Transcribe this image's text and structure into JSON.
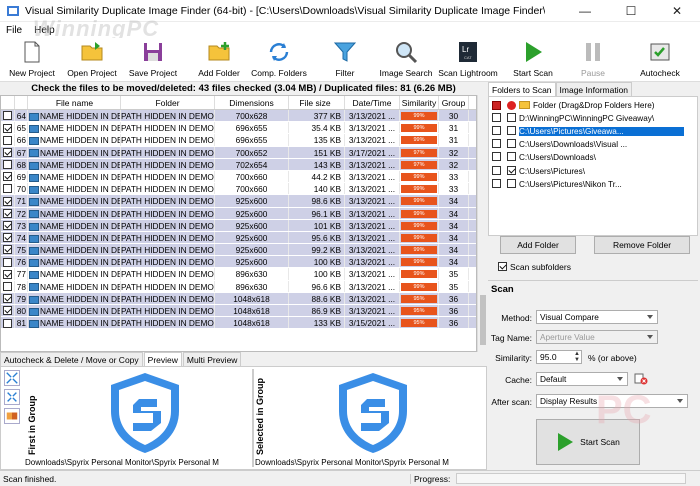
{
  "window": {
    "title": "Visual Similarity Duplicate Image Finder (64-bit) - [C:\\Users\\Downloads\\Visual Similarity Duplicate Image Finder\\Vis...",
    "minimize": "—",
    "maximize": "☐",
    "close": "✕"
  },
  "menu": {
    "file": "File",
    "help": "Help"
  },
  "watermark": "WinningPC",
  "toolbar": {
    "new_project": "New Project",
    "open_project": "Open Project",
    "save_project": "Save Project",
    "add_folder": "Add Folder",
    "comp_folders": "Comp. Folders",
    "filter": "Filter",
    "image_search": "Image Search",
    "scan_lightroom": "Scan Lightroom",
    "start_scan": "Start Scan",
    "pause": "Pause",
    "autocheck": "Autocheck"
  },
  "results": {
    "message": "Check the files to be moved/deleted: 43 files checked (3.04 MB) / Duplicated files: 81 (6.26 MB)",
    "headers": [
      "",
      "",
      "File name",
      "Folder",
      "Dimensions",
      "File size",
      "Date/Time",
      "Similarity",
      "Group"
    ],
    "rows": [
      {
        "n": "64",
        "checked": false,
        "name": "NAME HIDDEN IN DEM",
        "folder": "PATH HIDDEN IN DEMO",
        "dim": "700x628",
        "size": "377 KB",
        "date": "3/13/2021 ...",
        "sim": "99%",
        "group": "30",
        "hl": true
      },
      {
        "n": "65",
        "checked": true,
        "name": "NAME HIDDEN IN DEM",
        "folder": "PATH HIDDEN IN DEMO",
        "dim": "696x655",
        "size": "35.4 KB",
        "date": "3/13/2021 ...",
        "sim": "99%",
        "group": "31",
        "hl": false
      },
      {
        "n": "66",
        "checked": false,
        "name": "NAME HIDDEN IN DEM",
        "folder": "PATH HIDDEN IN DEMO",
        "dim": "696x655",
        "size": "135 KB",
        "date": "3/13/2021 ...",
        "sim": "99%",
        "group": "31",
        "hl": false
      },
      {
        "n": "67",
        "checked": true,
        "name": "NAME HIDDEN IN DEM",
        "folder": "PATH HIDDEN IN DEMO",
        "dim": "700x652",
        "size": "151 KB",
        "date": "3/17/2021 ...",
        "sim": "97%",
        "group": "32",
        "hl": true
      },
      {
        "n": "68",
        "checked": false,
        "name": "NAME HIDDEN IN DEM",
        "folder": "PATH HIDDEN IN DEMO",
        "dim": "702x654",
        "size": "143 KB",
        "date": "3/13/2021 ...",
        "sim": "97%",
        "group": "32",
        "hl": true
      },
      {
        "n": "69",
        "checked": true,
        "name": "NAME HIDDEN IN DEM",
        "folder": "PATH HIDDEN IN DEMO",
        "dim": "700x660",
        "size": "44.2 KB",
        "date": "3/13/2021 ...",
        "sim": "99%",
        "group": "33",
        "hl": false
      },
      {
        "n": "70",
        "checked": false,
        "name": "NAME HIDDEN IN DEM",
        "folder": "PATH HIDDEN IN DEMO",
        "dim": "700x660",
        "size": "140 KB",
        "date": "3/13/2021 ...",
        "sim": "99%",
        "group": "33",
        "hl": false
      },
      {
        "n": "71",
        "checked": true,
        "name": "NAME HIDDEN IN DEM",
        "folder": "PATH HIDDEN IN DEMO",
        "dim": "925x600",
        "size": "98.6 KB",
        "date": "3/13/2021 ...",
        "sim": "99%",
        "group": "34",
        "hl": true
      },
      {
        "n": "72",
        "checked": true,
        "name": "NAME HIDDEN IN DEM",
        "folder": "PATH HIDDEN IN DEMO",
        "dim": "925x600",
        "size": "96.1 KB",
        "date": "3/13/2021 ...",
        "sim": "99%",
        "group": "34",
        "hl": true
      },
      {
        "n": "73",
        "checked": true,
        "name": "NAME HIDDEN IN DEM",
        "folder": "PATH HIDDEN IN DEMO",
        "dim": "925x600",
        "size": "101 KB",
        "date": "3/13/2021 ...",
        "sim": "99%",
        "group": "34",
        "hl": true
      },
      {
        "n": "74",
        "checked": true,
        "name": "NAME HIDDEN IN DEM",
        "folder": "PATH HIDDEN IN DEMO",
        "dim": "925x600",
        "size": "95.6 KB",
        "date": "3/13/2021 ...",
        "sim": "99%",
        "group": "34",
        "hl": true
      },
      {
        "n": "75",
        "checked": true,
        "name": "NAME HIDDEN IN DEM",
        "folder": "PATH HIDDEN IN DEMO",
        "dim": "925x600",
        "size": "99.2 KB",
        "date": "3/13/2021 ...",
        "sim": "99%",
        "group": "34",
        "hl": true
      },
      {
        "n": "76",
        "checked": false,
        "name": "NAME HIDDEN IN DEM",
        "folder": "PATH HIDDEN IN DEMO",
        "dim": "925x600",
        "size": "100 KB",
        "date": "3/13/2021 ...",
        "sim": "99%",
        "group": "34",
        "hl": true
      },
      {
        "n": "77",
        "checked": true,
        "name": "NAME HIDDEN IN DEM",
        "folder": "PATH HIDDEN IN DEMO",
        "dim": "896x630",
        "size": "100 KB",
        "date": "3/13/2021 ...",
        "sim": "99%",
        "group": "35",
        "hl": false
      },
      {
        "n": "78",
        "checked": false,
        "name": "NAME HIDDEN IN DEM",
        "folder": "PATH HIDDEN IN DEMO",
        "dim": "896x630",
        "size": "96.6 KB",
        "date": "3/13/2021 ...",
        "sim": "99%",
        "group": "35",
        "hl": false
      },
      {
        "n": "79",
        "checked": true,
        "name": "NAME HIDDEN IN DEM",
        "folder": "PATH HIDDEN IN DEMO",
        "dim": "1048x618",
        "size": "88.6 KB",
        "date": "3/13/2021 ...",
        "sim": "95%",
        "group": "36",
        "hl": true
      },
      {
        "n": "80",
        "checked": true,
        "name": "NAME HIDDEN IN DEM",
        "folder": "PATH HIDDEN IN DEMO",
        "dim": "1048x618",
        "size": "86.9 KB",
        "date": "3/13/2021 ...",
        "sim": "95%",
        "group": "36",
        "hl": true
      },
      {
        "n": "81",
        "checked": false,
        "name": "NAME HIDDEN IN DEM",
        "folder": "PATH HIDDEN IN DEMO",
        "dim": "1048x618",
        "size": "133 KB",
        "date": "3/15/2021 ...",
        "sim": "95%",
        "group": "36",
        "hl": true
      }
    ]
  },
  "bottom_tabs": {
    "autocheck": "Autocheck & Delete / Move or Copy",
    "preview": "Preview",
    "multi_preview": "Multi Preview"
  },
  "preview": {
    "first_label": "First in Group",
    "selected_label": "Selected in Group",
    "first_path": "Downloads\\Spyrix Personal Monitor\\Spyrix Personal M",
    "selected_path": "Downloads\\Spyrix Personal Monitor\\Spyrix Personal M"
  },
  "right_tabs": {
    "folders": "Folders to Scan",
    "image_info": "Image Information"
  },
  "folders": [
    {
      "label": "Folder (Drag&Drop Folders Here)",
      "c1": false,
      "c2": false,
      "header": true,
      "sel": false
    },
    {
      "label": "D:\\WinningPC\\WinningPC Giveaway\\",
      "c1": false,
      "c2": false,
      "header": false,
      "sel": false
    },
    {
      "label": "C:\\Users\\Pictures\\Giveawa...",
      "c1": false,
      "c2": false,
      "header": false,
      "sel": true
    },
    {
      "label": "C:\\Users\\Downloads\\Visual ...",
      "c1": false,
      "c2": false,
      "header": false,
      "sel": false
    },
    {
      "label": "C:\\Users\\Downloads\\",
      "c1": false,
      "c2": false,
      "header": false,
      "sel": false
    },
    {
      "label": "C:\\Users\\Pictures\\",
      "c1": true,
      "c2": false,
      "header": false,
      "sel": false
    },
    {
      "label": "C:\\Users\\Pictures\\Nikon Tr...",
      "c1": false,
      "c2": false,
      "header": false,
      "sel": false
    }
  ],
  "folder_buttons": {
    "add": "Add Folder",
    "remove": "Remove Folder",
    "scan_sub": "Scan subfolders"
  },
  "scan": {
    "header": "Scan",
    "method_label": "Method:",
    "method_value": "Visual Compare",
    "tag_label": "Tag Name:",
    "tag_value": "Aperture Value",
    "similarity_label": "Similarity:",
    "similarity_value": "95.0",
    "similarity_suffix": "% (or above)",
    "cache_label": "Cache:",
    "cache_value": "Default",
    "after_label": "After scan:",
    "after_value": "Display Results",
    "start": "Start Scan"
  },
  "status": {
    "left": "Scan finished.",
    "progress": "Progress:"
  },
  "colors": {
    "accent": "#0a6fd4",
    "row_highlight": "#ced0e6",
    "similarity_bar": "#e8541c",
    "shield": "#3a8ee6"
  }
}
